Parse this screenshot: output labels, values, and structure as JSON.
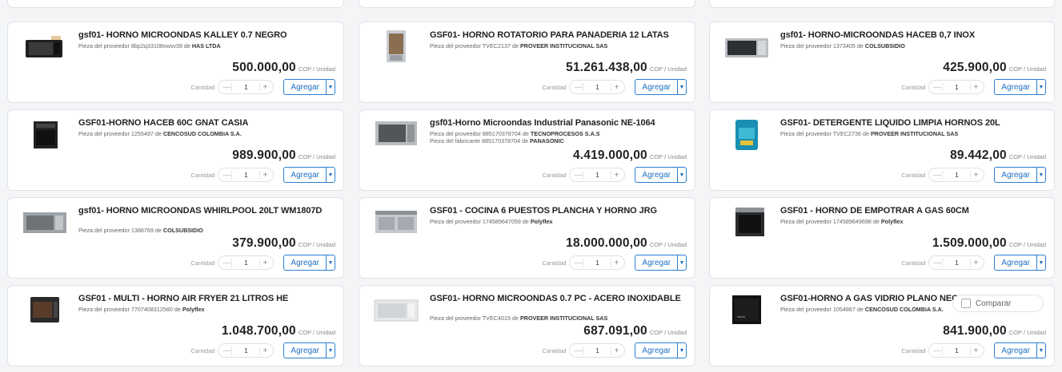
{
  "ui": {
    "qty_label": "Cantidad",
    "add_label": "Agregar",
    "unit": "COP / Unidad",
    "qty_value": "1",
    "minus": "—",
    "plus": "+",
    "compare": "Comparar"
  },
  "products": [
    {
      "title": "gsf01- HORNO MICROONDAS KALLEY 0.7 NEGRO",
      "line1_prefix": "Pieza del proveedor 8bp2q33108xwsv39 de ",
      "line1_brand": "HAS LTDA",
      "line2_prefix": "",
      "line2_brand": "",
      "price": "500.000,00",
      "icon": "microwave-black-icon"
    },
    {
      "title": "GSF01- HORNO ROTATORIO PARA PANADERIA 12 LATAS",
      "line1_prefix": "Pieza del proveedor TVEC2137 de ",
      "line1_brand": "PROVEER INSTITUCIONAL SAS",
      "line2_prefix": "",
      "line2_brand": "",
      "price": "51.261.438,00",
      "icon": "rotary-oven-icon"
    },
    {
      "title": "gsf01- HORNO-MICROONDAS HACEB 0,7 INOX",
      "line1_prefix": "Pieza del proveedor 1373405 de ",
      "line1_brand": "COLSUBSIDIO",
      "line2_prefix": "",
      "line2_brand": "",
      "price": "425.900,00",
      "icon": "microwave-steel-icon"
    },
    {
      "title": "GSF01-HORNO HACEB 60C GNAT CASIA",
      "line1_prefix": "Pieza del proveedor 1255497 de ",
      "line1_brand": "CENCOSUD COLOMBIA S.A.",
      "line2_prefix": "",
      "line2_brand": "",
      "price": "989.900,00",
      "icon": "built-in-oven-icon"
    },
    {
      "title": "gsf01-Horno Microondas Industrial Panasonic NE-1064",
      "line1_prefix": "Pieza del proveedor 885170378704 de ",
      "line1_brand": "TECNOPROCESOS S.A.S",
      "line2_prefix": "Pieza del fabricante 885170378704 de ",
      "line2_brand": "PANASONIC",
      "price": "4.419.000,00",
      "icon": "industrial-microwave-icon"
    },
    {
      "title": "GSF01- DETERGENTE LIQUIDO LIMPIA HORNOS 20L",
      "line1_prefix": "Pieza del proveedor TVEC2736 de ",
      "line1_brand": "PROVEER INSTITUCIONAL SAS",
      "line2_prefix": "",
      "line2_brand": "",
      "price": "89.442,00",
      "icon": "detergent-jug-icon"
    },
    {
      "title": "gsf01- HORNO MICROONDAS WHIRLPOOL 20LT WM1807D",
      "line1_prefix": "Pieza del proveedor 1386769 de ",
      "line1_brand": "COLSUBSIDIO",
      "line2_prefix": "",
      "line2_brand": "",
      "price": "379.900,00",
      "icon": "microwave-gray-icon"
    },
    {
      "title": "GSF01 - COCINA 6 PUESTOS PLANCHA Y HORNO JRG",
      "line1_prefix": "Pieza del proveedor 174589647059 de ",
      "line1_brand": "Polyflex",
      "line2_prefix": "",
      "line2_brand": "",
      "price": "18.000.000,00",
      "icon": "stove-icon"
    },
    {
      "title": "GSF01 - HORNO DE EMPOTRAR A GAS 60CM",
      "line1_prefix": "Pieza del proveedor 174589649698 de ",
      "line1_brand": "Polyflex",
      "line2_prefix": "",
      "line2_brand": "",
      "price": "1.509.000,00",
      "icon": "gas-oven-icon"
    },
    {
      "title": "GSF01 - MULTI - HORNO AIR FRYER 21 LITROS HE",
      "line1_prefix": "Pieza del proveedor 7707408312560 de ",
      "line1_brand": "Polyflex",
      "line2_prefix": "",
      "line2_brand": "",
      "price": "1.048.700,00",
      "icon": "air-fryer-icon"
    },
    {
      "title": "GSF01- HORNO MICROONDAS 0.7 PC - ACERO INOXIDABLE",
      "line1_prefix": "Pieza del proveedor TVEC4015 de ",
      "line1_brand": "PROVEER INSTITUCIONAL SAS",
      "line2_prefix": "",
      "line2_brand": "",
      "price": "687.091,00",
      "icon": "microwave-white-icon"
    },
    {
      "title": "GSF01-HORNO A GAS VIDRIO PLANO NEGRO",
      "line1_prefix": "Pieza del proveedor 1054867 de ",
      "line1_brand": "CENCOSUD COLOMBIA S.A.",
      "line2_prefix": "",
      "line2_brand": "",
      "price": "841.900,00",
      "icon": "black-glass-oven-icon"
    }
  ]
}
